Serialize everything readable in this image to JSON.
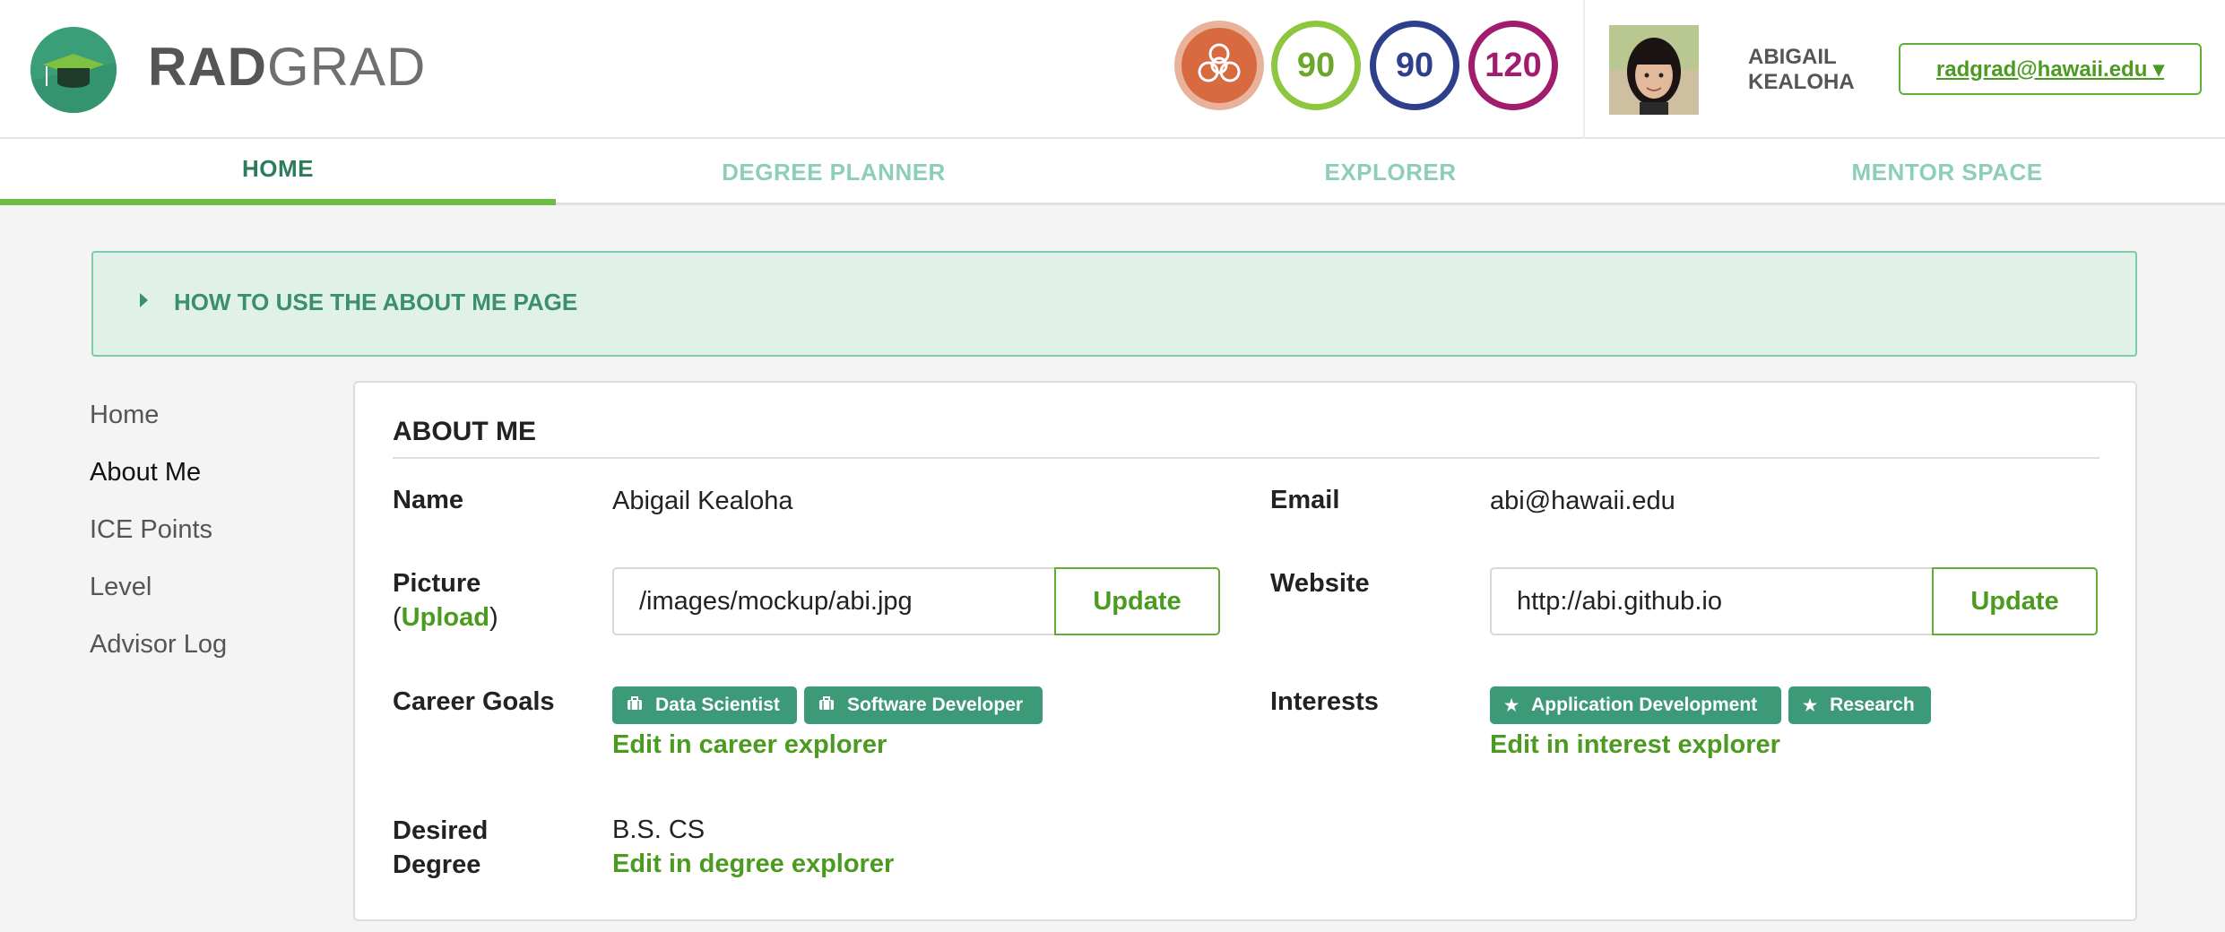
{
  "header": {
    "logo": {
      "bold": "RAD",
      "light": "GRAD"
    },
    "points": {
      "ice_icon": "ice-icon",
      "i_value": "90",
      "c_value": "90",
      "e_value": "120"
    },
    "user": {
      "first": "ABIGAIL",
      "last": "KEALOHA"
    },
    "account_button": "radgrad@hawaii.edu ▾"
  },
  "nav": {
    "items": [
      "HOME",
      "DEGREE PLANNER",
      "EXPLORER",
      "MENTOR SPACE"
    ],
    "active": "HOME"
  },
  "accordion": {
    "title": "HOW TO USE THE ABOUT ME PAGE"
  },
  "side_menu": {
    "items": [
      "Home",
      "About Me",
      "ICE Points",
      "Level",
      "Advisor Log"
    ],
    "active": "About Me"
  },
  "about": {
    "title": "ABOUT ME",
    "name_label": "Name",
    "name_value": "Abigail Kealoha",
    "email_label": "Email",
    "email_value": "abi@hawaii.edu",
    "picture_label": "Picture",
    "picture_upload_open": "(",
    "picture_upload_link": "Upload",
    "picture_upload_close": ")",
    "picture_value": "/images/mockup/abi.jpg",
    "picture_update": "Update",
    "website_label": "Website",
    "website_value": "http://abi.github.io",
    "website_update": "Update",
    "career_label": "Career Goals",
    "career_tags": [
      "Data Scientist",
      "Software Developer"
    ],
    "career_edit": "Edit in career explorer",
    "interests_label": "Interests",
    "interest_tags": [
      "Application Development",
      "Research"
    ],
    "interest_edit": "Edit in interest explorer",
    "degree_label_1": "Desired",
    "degree_label_2": "Degree",
    "degree_value": "B.S. CS",
    "degree_edit": "Edit in degree explorer"
  },
  "colors": {
    "brand_green": "#3a9e78",
    "link_green": "#4a9b20",
    "tag_teal": "#3d9a79",
    "innovation": "#8dc63f",
    "competency": "#2e3f8c",
    "experience": "#a11c6c"
  }
}
